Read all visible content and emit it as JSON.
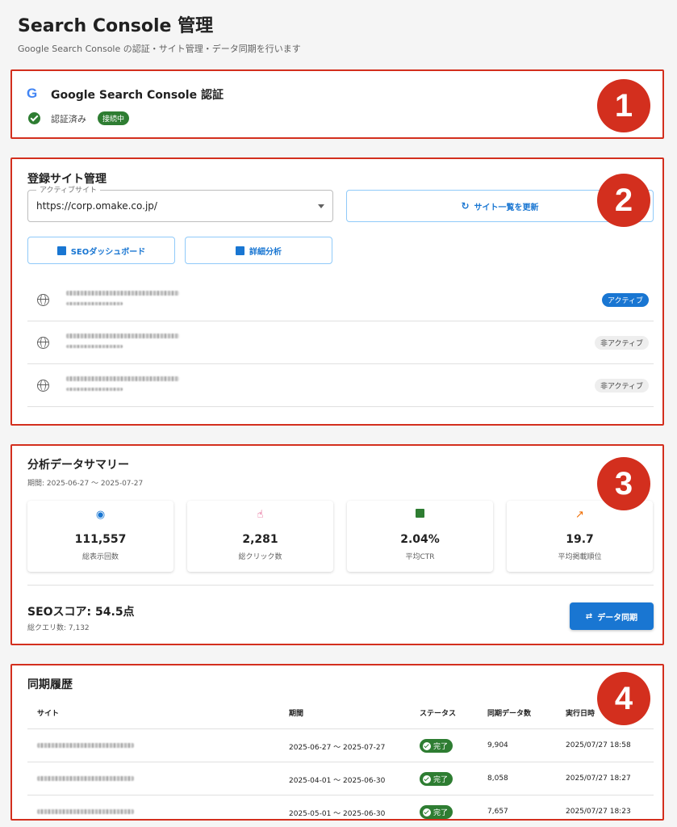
{
  "page": {
    "title": "Search Console 管理",
    "subtitle": "Google Search Console の認証・サイト管理・データ同期を行います"
  },
  "colors": {
    "accent": "#1976d2",
    "success": "#2e7d32",
    "callout": "#d32f1e"
  },
  "callouts": [
    "1",
    "2",
    "3",
    "4"
  ],
  "auth": {
    "logo": "G",
    "title": "Google Search Console 認証",
    "status": "認証済み",
    "badge": "接続中"
  },
  "sites": {
    "title": "登録サイト管理",
    "select_label": "アクティブサイト",
    "select_value": "https://corp.omake.co.jp/",
    "refresh_label": "サイト一覧を更新",
    "dashboard_label": "SEOダッシュボード",
    "analysis_label": "詳細分析",
    "rows": [
      {
        "status": "アクティブ",
        "icon": "globe-icon"
      },
      {
        "status": "非アクティブ",
        "icon": "globe-icon"
      },
      {
        "status": "非アクティブ",
        "icon": "globe-icon"
      }
    ]
  },
  "summary": {
    "title": "分析データサマリー",
    "period": "期間: 2025-06-27 〜 2025-07-27",
    "metrics": [
      {
        "icon": "eye-icon",
        "value": "111,557",
        "label": "総表示回数"
      },
      {
        "icon": "touch-icon",
        "value": "2,281",
        "label": "総クリック数"
      },
      {
        "icon": "bar-chart-icon",
        "value": "2.04%",
        "label": "平均CTR"
      },
      {
        "icon": "trending-up-icon",
        "value": "19.7",
        "label": "平均掲載順位"
      }
    ],
    "seo_score": "SEOスコア: 54.5点",
    "query_count": "総クエリ数: 7,132",
    "sync_label": "データ同期"
  },
  "history": {
    "title": "同期履歴",
    "columns": [
      "サイト",
      "期間",
      "ステータス",
      "同期データ数",
      "実行日時"
    ],
    "rows": [
      {
        "period": "2025-06-27 〜 2025-07-27",
        "status": "完了",
        "count": "9,904",
        "executed": "2025/07/27 18:58"
      },
      {
        "period": "2025-04-01 〜 2025-06-30",
        "status": "完了",
        "count": "8,058",
        "executed": "2025/07/27 18:27"
      },
      {
        "period": "2025-05-01 〜 2025-06-30",
        "status": "完了",
        "count": "7,657",
        "executed": "2025/07/27 18:23"
      }
    ]
  }
}
